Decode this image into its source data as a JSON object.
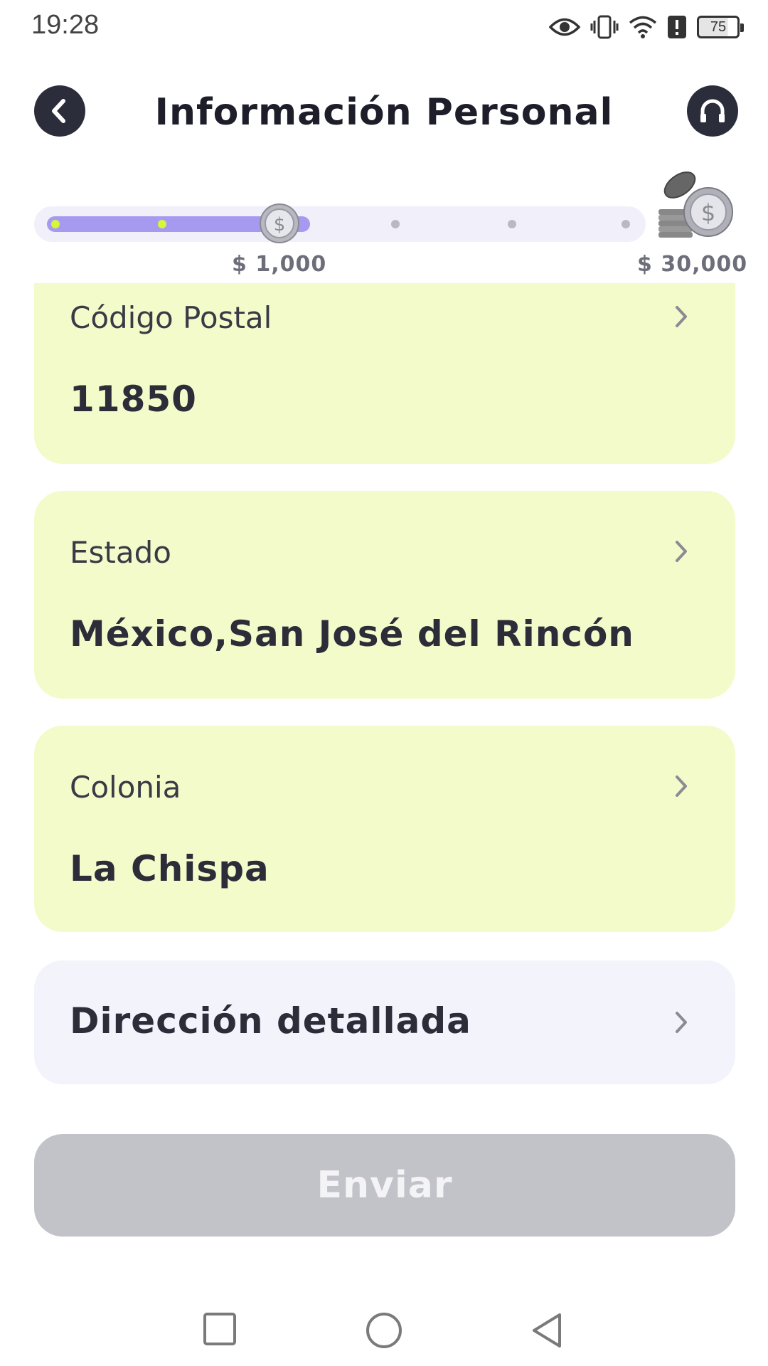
{
  "status_bar": {
    "time": "19:28",
    "battery": "75",
    "icons": [
      "eye-icon",
      "vibrate-icon",
      "wifi-icon",
      "alert-icon",
      "battery-icon"
    ]
  },
  "header": {
    "title": "Información Personal",
    "back_icon": "chevron-left-icon",
    "support_icon": "headset-icon"
  },
  "progress": {
    "current_amount": "$ 1,000",
    "max_amount": "$ 30,000",
    "fraction": 0.43,
    "accent_color": "#a69af0",
    "done_dot_color": "#d7f53a"
  },
  "fields": {
    "postal_code": {
      "label": "Código Postal",
      "value": "11850"
    },
    "state": {
      "label": "Estado",
      "value": "México,San José del Rincón"
    },
    "colony": {
      "label": "Colonia",
      "value": "La Chispa"
    },
    "address": {
      "label": "Dirección detallada"
    }
  },
  "colors": {
    "filled_card": "#f3fbca",
    "empty_card": "#f3f3fc",
    "button_disabled": "#c2c2c9"
  },
  "submit": {
    "label": "Enviar"
  },
  "nav": {
    "icons": [
      "recent-apps-icon",
      "home-icon",
      "back-icon"
    ]
  }
}
